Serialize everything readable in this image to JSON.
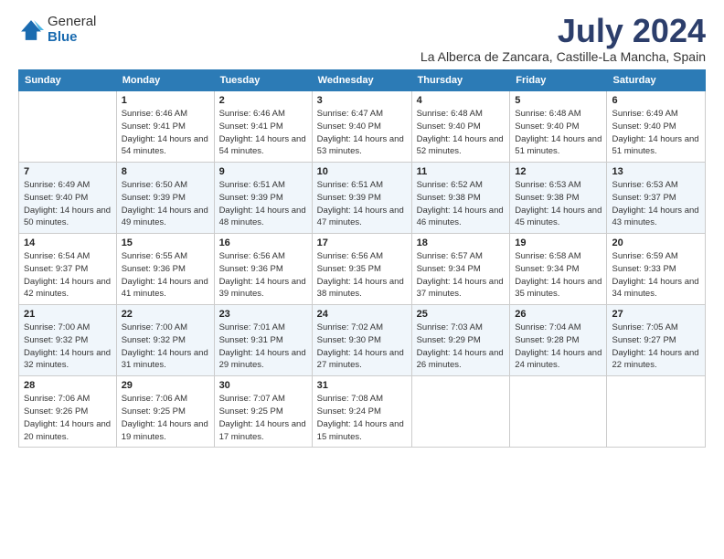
{
  "logo": {
    "general": "General",
    "blue": "Blue"
  },
  "title": "July 2024",
  "location": "La Alberca de Zancara, Castille-La Mancha, Spain",
  "headers": [
    "Sunday",
    "Monday",
    "Tuesday",
    "Wednesday",
    "Thursday",
    "Friday",
    "Saturday"
  ],
  "weeks": [
    [
      {
        "day": "",
        "sunrise": "",
        "sunset": "",
        "daylight": ""
      },
      {
        "day": "1",
        "sunrise": "Sunrise: 6:46 AM",
        "sunset": "Sunset: 9:41 PM",
        "daylight": "Daylight: 14 hours and 54 minutes."
      },
      {
        "day": "2",
        "sunrise": "Sunrise: 6:46 AM",
        "sunset": "Sunset: 9:41 PM",
        "daylight": "Daylight: 14 hours and 54 minutes."
      },
      {
        "day": "3",
        "sunrise": "Sunrise: 6:47 AM",
        "sunset": "Sunset: 9:40 PM",
        "daylight": "Daylight: 14 hours and 53 minutes."
      },
      {
        "day": "4",
        "sunrise": "Sunrise: 6:48 AM",
        "sunset": "Sunset: 9:40 PM",
        "daylight": "Daylight: 14 hours and 52 minutes."
      },
      {
        "day": "5",
        "sunrise": "Sunrise: 6:48 AM",
        "sunset": "Sunset: 9:40 PM",
        "daylight": "Daylight: 14 hours and 51 minutes."
      },
      {
        "day": "6",
        "sunrise": "Sunrise: 6:49 AM",
        "sunset": "Sunset: 9:40 PM",
        "daylight": "Daylight: 14 hours and 51 minutes."
      }
    ],
    [
      {
        "day": "7",
        "sunrise": "Sunrise: 6:49 AM",
        "sunset": "Sunset: 9:40 PM",
        "daylight": "Daylight: 14 hours and 50 minutes."
      },
      {
        "day": "8",
        "sunrise": "Sunrise: 6:50 AM",
        "sunset": "Sunset: 9:39 PM",
        "daylight": "Daylight: 14 hours and 49 minutes."
      },
      {
        "day": "9",
        "sunrise": "Sunrise: 6:51 AM",
        "sunset": "Sunset: 9:39 PM",
        "daylight": "Daylight: 14 hours and 48 minutes."
      },
      {
        "day": "10",
        "sunrise": "Sunrise: 6:51 AM",
        "sunset": "Sunset: 9:39 PM",
        "daylight": "Daylight: 14 hours and 47 minutes."
      },
      {
        "day": "11",
        "sunrise": "Sunrise: 6:52 AM",
        "sunset": "Sunset: 9:38 PM",
        "daylight": "Daylight: 14 hours and 46 minutes."
      },
      {
        "day": "12",
        "sunrise": "Sunrise: 6:53 AM",
        "sunset": "Sunset: 9:38 PM",
        "daylight": "Daylight: 14 hours and 45 minutes."
      },
      {
        "day": "13",
        "sunrise": "Sunrise: 6:53 AM",
        "sunset": "Sunset: 9:37 PM",
        "daylight": "Daylight: 14 hours and 43 minutes."
      }
    ],
    [
      {
        "day": "14",
        "sunrise": "Sunrise: 6:54 AM",
        "sunset": "Sunset: 9:37 PM",
        "daylight": "Daylight: 14 hours and 42 minutes."
      },
      {
        "day": "15",
        "sunrise": "Sunrise: 6:55 AM",
        "sunset": "Sunset: 9:36 PM",
        "daylight": "Daylight: 14 hours and 41 minutes."
      },
      {
        "day": "16",
        "sunrise": "Sunrise: 6:56 AM",
        "sunset": "Sunset: 9:36 PM",
        "daylight": "Daylight: 14 hours and 39 minutes."
      },
      {
        "day": "17",
        "sunrise": "Sunrise: 6:56 AM",
        "sunset": "Sunset: 9:35 PM",
        "daylight": "Daylight: 14 hours and 38 minutes."
      },
      {
        "day": "18",
        "sunrise": "Sunrise: 6:57 AM",
        "sunset": "Sunset: 9:34 PM",
        "daylight": "Daylight: 14 hours and 37 minutes."
      },
      {
        "day": "19",
        "sunrise": "Sunrise: 6:58 AM",
        "sunset": "Sunset: 9:34 PM",
        "daylight": "Daylight: 14 hours and 35 minutes."
      },
      {
        "day": "20",
        "sunrise": "Sunrise: 6:59 AM",
        "sunset": "Sunset: 9:33 PM",
        "daylight": "Daylight: 14 hours and 34 minutes."
      }
    ],
    [
      {
        "day": "21",
        "sunrise": "Sunrise: 7:00 AM",
        "sunset": "Sunset: 9:32 PM",
        "daylight": "Daylight: 14 hours and 32 minutes."
      },
      {
        "day": "22",
        "sunrise": "Sunrise: 7:00 AM",
        "sunset": "Sunset: 9:32 PM",
        "daylight": "Daylight: 14 hours and 31 minutes."
      },
      {
        "day": "23",
        "sunrise": "Sunrise: 7:01 AM",
        "sunset": "Sunset: 9:31 PM",
        "daylight": "Daylight: 14 hours and 29 minutes."
      },
      {
        "day": "24",
        "sunrise": "Sunrise: 7:02 AM",
        "sunset": "Sunset: 9:30 PM",
        "daylight": "Daylight: 14 hours and 27 minutes."
      },
      {
        "day": "25",
        "sunrise": "Sunrise: 7:03 AM",
        "sunset": "Sunset: 9:29 PM",
        "daylight": "Daylight: 14 hours and 26 minutes."
      },
      {
        "day": "26",
        "sunrise": "Sunrise: 7:04 AM",
        "sunset": "Sunset: 9:28 PM",
        "daylight": "Daylight: 14 hours and 24 minutes."
      },
      {
        "day": "27",
        "sunrise": "Sunrise: 7:05 AM",
        "sunset": "Sunset: 9:27 PM",
        "daylight": "Daylight: 14 hours and 22 minutes."
      }
    ],
    [
      {
        "day": "28",
        "sunrise": "Sunrise: 7:06 AM",
        "sunset": "Sunset: 9:26 PM",
        "daylight": "Daylight: 14 hours and 20 minutes."
      },
      {
        "day": "29",
        "sunrise": "Sunrise: 7:06 AM",
        "sunset": "Sunset: 9:25 PM",
        "daylight": "Daylight: 14 hours and 19 minutes."
      },
      {
        "day": "30",
        "sunrise": "Sunrise: 7:07 AM",
        "sunset": "Sunset: 9:25 PM",
        "daylight": "Daylight: 14 hours and 17 minutes."
      },
      {
        "day": "31",
        "sunrise": "Sunrise: 7:08 AM",
        "sunset": "Sunset: 9:24 PM",
        "daylight": "Daylight: 14 hours and 15 minutes."
      },
      {
        "day": "",
        "sunrise": "",
        "sunset": "",
        "daylight": ""
      },
      {
        "day": "",
        "sunrise": "",
        "sunset": "",
        "daylight": ""
      },
      {
        "day": "",
        "sunrise": "",
        "sunset": "",
        "daylight": ""
      }
    ]
  ]
}
